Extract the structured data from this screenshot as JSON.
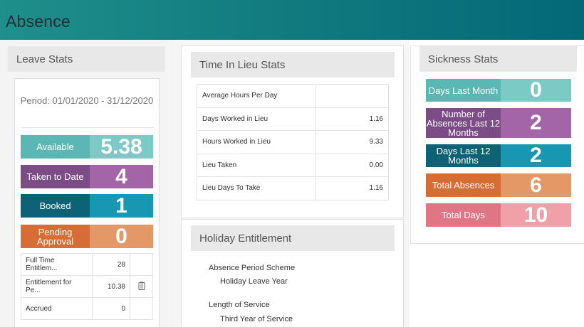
{
  "header": {
    "title": "Absence"
  },
  "leave_stats": {
    "title": "Leave Stats",
    "period": "Period: 01/01/2020 - 31/12/2020",
    "tiles": [
      {
        "label": "Available",
        "value": "5.38",
        "label_color": "#5bb7b4",
        "value_color": "#7ccac6"
      },
      {
        "label": "Taken to Date",
        "value": "4",
        "label_color": "#7b4c86",
        "value_color": "#a464a8"
      },
      {
        "label": "Booked",
        "value": "1",
        "label_color": "#0e6276",
        "value_color": "#1797b2"
      },
      {
        "label": "Pending Approval",
        "value": "0",
        "label_color": "#d56d35",
        "value_color": "#e39866"
      }
    ],
    "table": [
      {
        "label": "Full Time Entitlem...",
        "value": "28",
        "icon": ""
      },
      {
        "label": "Entitlement for Pe...",
        "value": "10.38",
        "icon": "clipboard-icon"
      },
      {
        "label": "Accrued",
        "value": "0",
        "icon": ""
      }
    ]
  },
  "lieu_stats": {
    "title": "Time In Lieu Stats",
    "rows": [
      {
        "label": "Average Hours Per Day",
        "value": ""
      },
      {
        "label": "Days Worked in Lieu",
        "value": "1.16"
      },
      {
        "label": "Hours Worked in Lieu",
        "value": "9.33"
      },
      {
        "label": "Lieu Taken",
        "value": "0.00"
      },
      {
        "label": "Lieu Days To Take",
        "value": "1.16"
      }
    ]
  },
  "holiday_entitlement": {
    "title": "Holiday Entitlement",
    "items": [
      {
        "label": "Absence Period Scheme",
        "value": "Holiday Leave Year"
      },
      {
        "label": "Length of Service",
        "value": "Third Year of Service"
      }
    ]
  },
  "sickness_stats": {
    "title": "Sickness Stats",
    "tiles": [
      {
        "label": "Days Last Month",
        "value": "0",
        "label_color": "#5bb7b4",
        "value_color": "#7ccac6"
      },
      {
        "label": "Number of Absences Last 12 Months",
        "value": "2",
        "label_color": "#7b4c86",
        "value_color": "#a464a8"
      },
      {
        "label": "Days Last 12 Months",
        "value": "2",
        "label_color": "#0e6276",
        "value_color": "#1797b2"
      },
      {
        "label": "Total Absences",
        "value": "6",
        "label_color": "#d56d35",
        "value_color": "#e39866"
      },
      {
        "label": "Total Days",
        "value": "10",
        "label_color": "#e07684",
        "value_color": "#f0a0a8"
      }
    ]
  }
}
